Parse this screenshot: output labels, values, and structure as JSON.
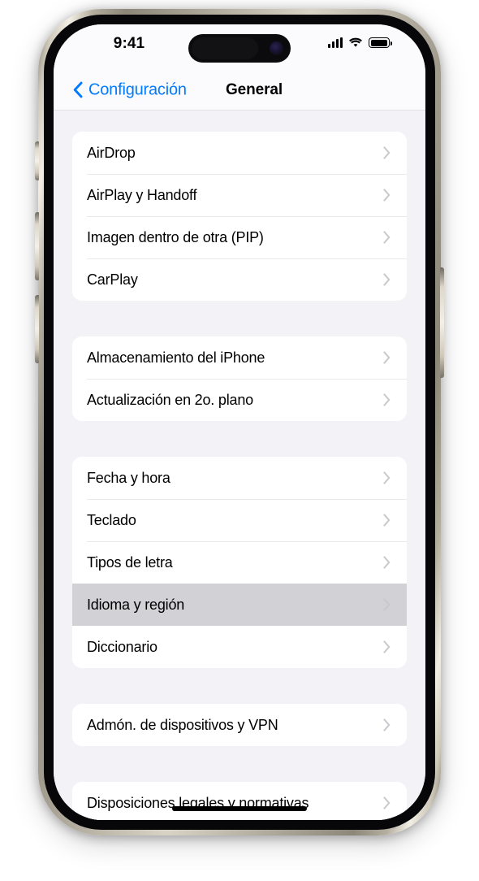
{
  "status_bar": {
    "time": "9:41",
    "cellular_icon": "cellular-bars-icon",
    "cellular_bars": 4,
    "wifi_icon": "wifi-icon",
    "battery_icon": "battery-full-icon"
  },
  "nav_bar": {
    "back_label": "Configuración",
    "back_icon": "chevron-left-icon",
    "title": "General"
  },
  "colors": {
    "accent": "#007AFF",
    "page_background": "#F2F2F7",
    "card_background": "#FFFFFF",
    "selected_row": "#D1D1D6",
    "separator": "#E9E9EB",
    "chevron": "#C7C7CC",
    "label": "#000000"
  },
  "groups": [
    {
      "rows": [
        {
          "label": "AirDrop",
          "chevron": "chevron-right-icon",
          "selected": false
        },
        {
          "label": "AirPlay y Handoff",
          "chevron": "chevron-right-icon",
          "selected": false
        },
        {
          "label": "Imagen dentro de otra (PIP)",
          "chevron": "chevron-right-icon",
          "selected": false
        },
        {
          "label": "CarPlay",
          "chevron": "chevron-right-icon",
          "selected": false
        }
      ]
    },
    {
      "rows": [
        {
          "label": "Almacenamiento del iPhone",
          "chevron": "chevron-right-icon",
          "selected": false
        },
        {
          "label": "Actualización en 2o. plano",
          "chevron": "chevron-right-icon",
          "selected": false
        }
      ]
    },
    {
      "rows": [
        {
          "label": "Fecha y hora",
          "chevron": "chevron-right-icon",
          "selected": false
        },
        {
          "label": "Teclado",
          "chevron": "chevron-right-icon",
          "selected": false
        },
        {
          "label": "Tipos de letra",
          "chevron": "chevron-right-icon",
          "selected": false
        },
        {
          "label": "Idioma y región",
          "chevron": "chevron-right-icon",
          "selected": true
        },
        {
          "label": "Diccionario",
          "chevron": "chevron-right-icon",
          "selected": false
        }
      ]
    },
    {
      "rows": [
        {
          "label": "Admón. de dispositivos y VPN",
          "chevron": "chevron-right-icon",
          "selected": false
        }
      ]
    },
    {
      "rows": [
        {
          "label": "Disposiciones legales y normativas",
          "chevron": "chevron-right-icon",
          "selected": false
        }
      ]
    }
  ]
}
